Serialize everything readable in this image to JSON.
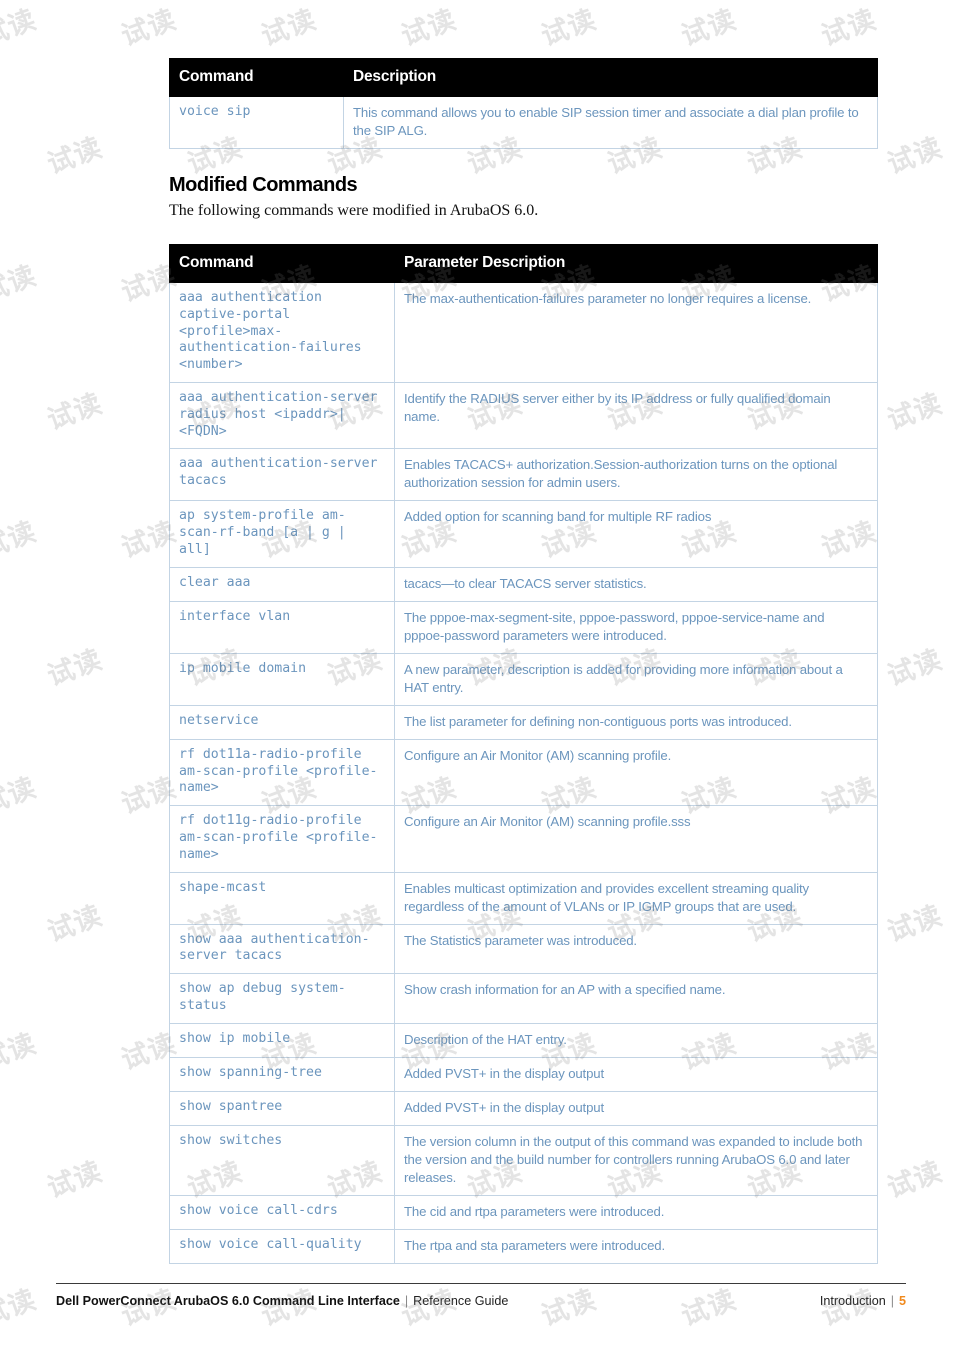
{
  "tables": {
    "new_commands": {
      "headers": [
        "Command",
        "Description"
      ],
      "rows": [
        {
          "command": "voice sip",
          "description": "This command allows you to enable SIP session timer and associate a dial plan profile to the SIP ALG."
        }
      ]
    },
    "modified_commands": {
      "headers": [
        "Command",
        "Parameter Description"
      ],
      "rows": [
        {
          "command": "aaa authentication captive-portal <profile>max-authentication-failures <number>",
          "description": "The max-authentication-failures parameter no longer requires a license."
        },
        {
          "command": "aaa authentication-server radius host <ipaddr>|<FQDN>",
          "description": "Identify the RADIUS server either by its IP address or fully qualified domain name."
        },
        {
          "command": "aaa authentication-server tacacs",
          "description": "Enables TACACS+ authorization.Session-authorization turns on the optional authorization session for admin users."
        },
        {
          "command": "ap system-profile am-scan-rf-band [a | g | all]",
          "description": "Added option for scanning band for multiple RF radios"
        },
        {
          "command": "clear aaa",
          "description": "tacacs—to clear TACACS server statistics."
        },
        {
          "command": "interface vlan",
          "description": "The pppoe-max-segment-site, pppoe-password, pppoe-service-name and pppoe-password parameters were introduced."
        },
        {
          "command": "ip mobile domain",
          "description": "A new parameter, description is added for providing more information about a HAT entry."
        },
        {
          "command": "netservice",
          "description": "The list parameter for defining non-contiguous ports was introduced."
        },
        {
          "command": "rf dot11a-radio-profile am-scan-profile <profile-name>",
          "description": "Configure an Air Monitor (AM) scanning profile."
        },
        {
          "command": "rf dot11g-radio-profile am-scan-profile <profile-name>",
          "description": "Configure an Air Monitor (AM) scanning profile.sss"
        },
        {
          "command": "shape-mcast",
          "description": "Enables multicast optimization and provides excellent streaming quality regardless of the amount of VLANs or IP IGMP groups that are used."
        },
        {
          "command": "show aaa authentication-server tacacs",
          "description": "The Statistics parameter was introduced."
        },
        {
          "command": "show ap debug system-status",
          "description": "Show crash information for an AP with a specified name."
        },
        {
          "command": "show ip mobile",
          "description": "Description of the HAT entry."
        },
        {
          "command": "show spanning-tree",
          "description": "Added PVST+ in the display output"
        },
        {
          "command": "show spantree",
          "description": "Added PVST+ in the display output"
        },
        {
          "command": "show switches",
          "description": "The version column in the output of this command was expanded to include both the version and the build number for controllers running ArubaOS 6.0 and later releases."
        },
        {
          "command": "show voice call-cdrs",
          "description": "The cid and rtpa parameters were introduced."
        },
        {
          "command": "show voice call-quality",
          "description": "The rtpa and sta parameters were introduced."
        }
      ]
    }
  },
  "section": {
    "title": "Modified Commands",
    "intro": "The following commands were modified in ArubaOS 6.0."
  },
  "footer": {
    "title": "Dell PowerConnect ArubaOS 6.0 Command Line Interface",
    "separator": "|",
    "subtitle": "Reference Guide",
    "chapter": "Introduction",
    "page_number": "5"
  },
  "watermark": {
    "text": "试读",
    "repeat_count": 60
  },
  "colors": {
    "header_bg": "#000000",
    "command_text": "#6b95bd",
    "description_text": "#6b95bd",
    "table_border": "#c3d4e4",
    "page_number": "#f08a1e"
  }
}
